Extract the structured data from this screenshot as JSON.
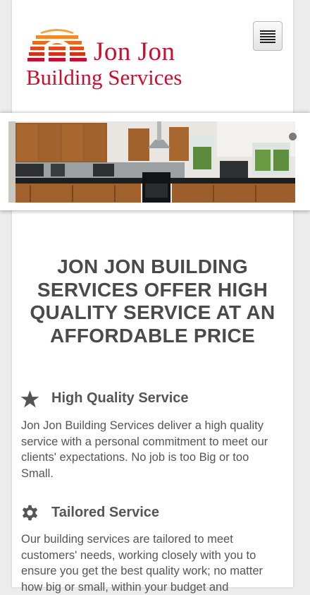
{
  "header": {
    "logo_line1": "Jon Jon",
    "logo_line2": "Building Services",
    "menu_icon": "hamburger-menu-icon"
  },
  "slider": {
    "slide_count_dots": 1,
    "active_dot": 1
  },
  "main": {
    "headline": "JON JON BUILDING SERVICES OFFER HIGH QUALITY SERVICE AT AN AFFORDABLE PRICE",
    "features": [
      {
        "icon": "star-icon",
        "title": "High Quality Service",
        "text": "Jon Jon Building Services deliver a high quality service with a personal commitment to meet our clients' expectations. No job is too Big or too Small."
      },
      {
        "icon": "gear-icon",
        "title": "Tailored Service",
        "text": "Our building services are tailored to meet customers' needs, working closely with you to ensure you get the best quality work; no matter how big or small, within your budget and"
      }
    ]
  },
  "colors": {
    "brand_red": "#c8102e",
    "text_gray": "#555555",
    "heading_gray": "#4a4a4a"
  }
}
